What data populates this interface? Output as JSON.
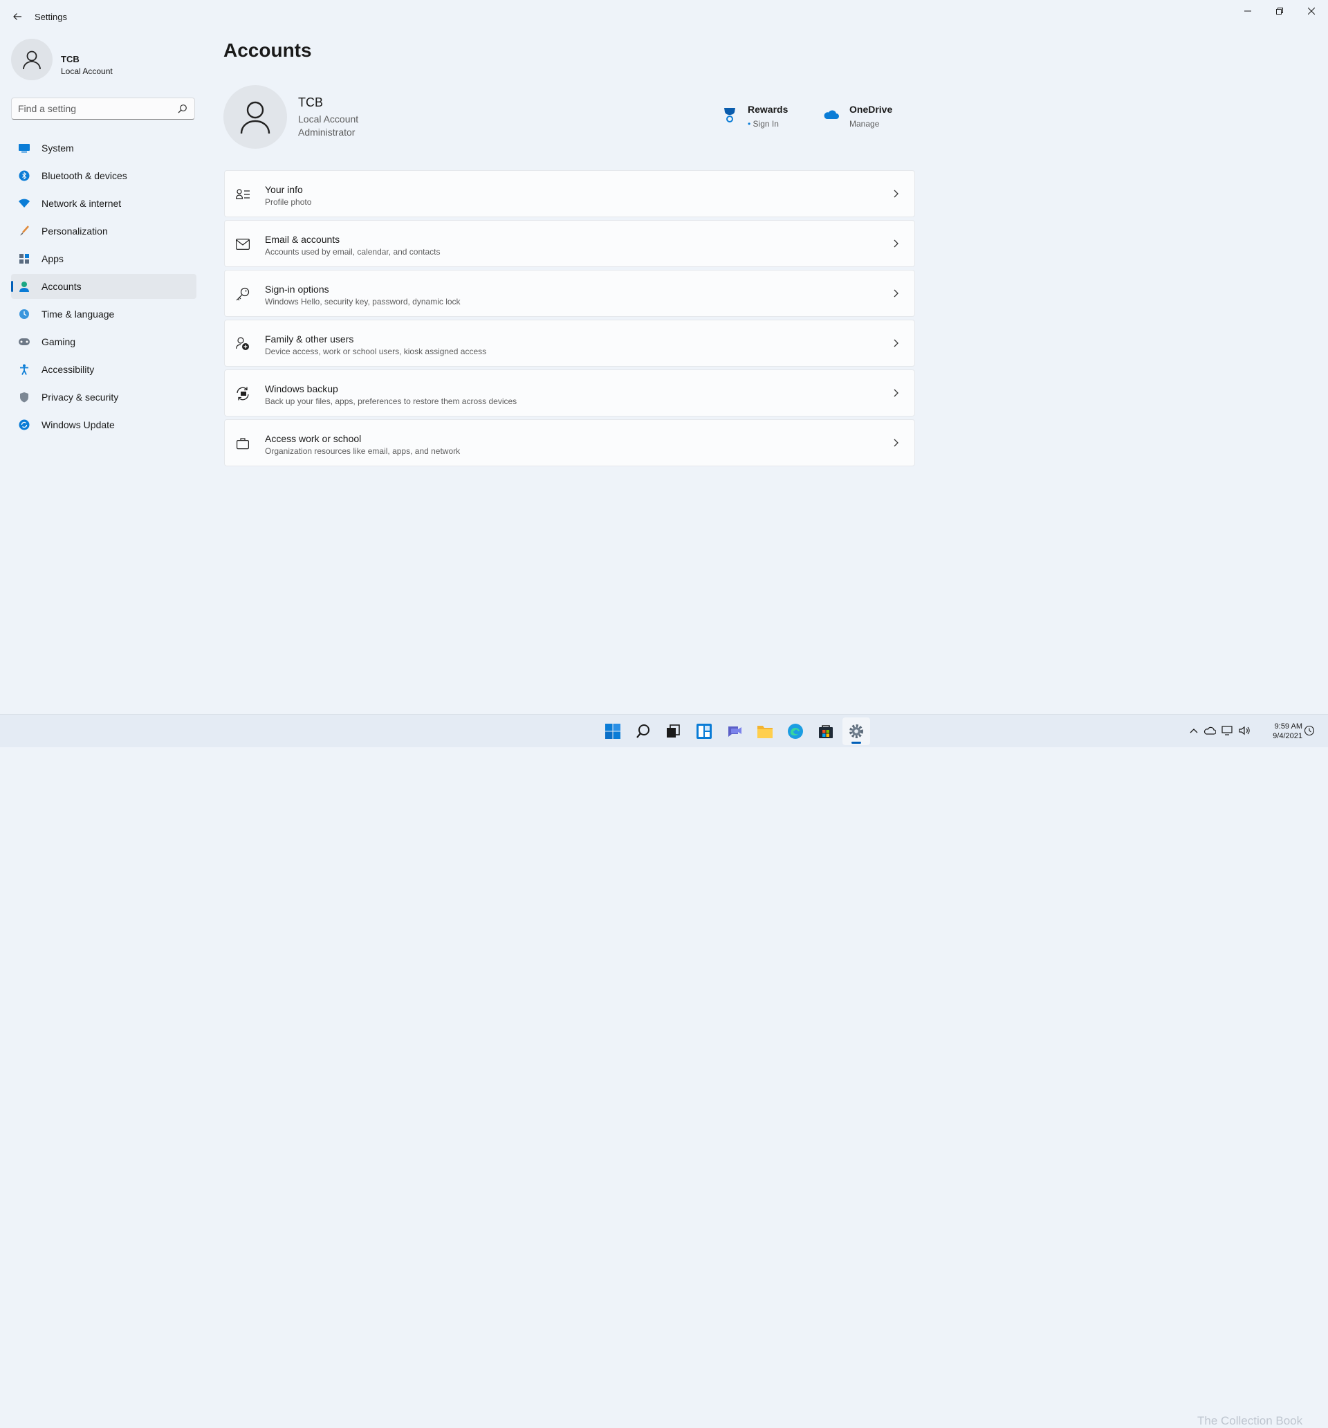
{
  "window": {
    "title": "Settings",
    "icons": {
      "back": "back-arrow-icon",
      "minimize": "minimize-icon",
      "restore": "restore-icon",
      "close": "close-icon"
    }
  },
  "sidebar": {
    "profile": {
      "name": "TCB",
      "type": "Local Account"
    },
    "search": {
      "placeholder": "Find a setting",
      "value": ""
    },
    "items": [
      {
        "label": "System",
        "icon": "system-icon"
      },
      {
        "label": "Bluetooth & devices",
        "icon": "bluetooth-icon"
      },
      {
        "label": "Network & internet",
        "icon": "network-icon"
      },
      {
        "label": "Personalization",
        "icon": "brush-icon"
      },
      {
        "label": "Apps",
        "icon": "apps-icon"
      },
      {
        "label": "Accounts",
        "icon": "accounts-icon",
        "selected": true
      },
      {
        "label": "Time & language",
        "icon": "globe-clock-icon"
      },
      {
        "label": "Gaming",
        "icon": "gamepad-icon"
      },
      {
        "label": "Accessibility",
        "icon": "accessibility-icon"
      },
      {
        "label": "Privacy & security",
        "icon": "shield-icon"
      },
      {
        "label": "Windows Update",
        "icon": "update-icon"
      }
    ]
  },
  "main": {
    "title": "Accounts",
    "user": {
      "name": "TCB",
      "type": "Local Account",
      "role": "Administrator"
    },
    "services": [
      {
        "title": "Rewards",
        "subtitle": "Sign In",
        "icon": "rewards-trophy-icon"
      },
      {
        "title": "OneDrive",
        "subtitle": "Manage",
        "icon": "onedrive-cloud-icon"
      }
    ],
    "cards": [
      {
        "title": "Your info",
        "subtitle": "Profile photo",
        "icon": "person-info-icon"
      },
      {
        "title": "Email & accounts",
        "subtitle": "Accounts used by email, calendar, and contacts",
        "icon": "mail-icon"
      },
      {
        "title": "Sign-in options",
        "subtitle": "Windows Hello, security key, password, dynamic lock",
        "icon": "key-icon"
      },
      {
        "title": "Family & other users",
        "subtitle": "Device access, work or school users, kiosk assigned access",
        "icon": "family-icon"
      },
      {
        "title": "Windows backup",
        "subtitle": "Back up your files, apps, preferences to restore them across devices",
        "icon": "backup-icon"
      },
      {
        "title": "Access work or school",
        "subtitle": "Organization resources like email, apps, and network",
        "icon": "briefcase-icon"
      }
    ]
  },
  "taskbar": {
    "apps": [
      "start-icon",
      "search-icon",
      "task-view-icon",
      "widgets-icon",
      "chat-icon",
      "file-explorer-icon",
      "edge-icon",
      "store-icon",
      "settings-icon"
    ],
    "active_app": "settings-icon",
    "clock": {
      "time": "9:59 AM",
      "date": "9/4/2021"
    },
    "watermark": "The Collection Book"
  },
  "colors": {
    "accent": "#005fb8",
    "background": "#eef3f9",
    "card": "#fbfcfd"
  }
}
